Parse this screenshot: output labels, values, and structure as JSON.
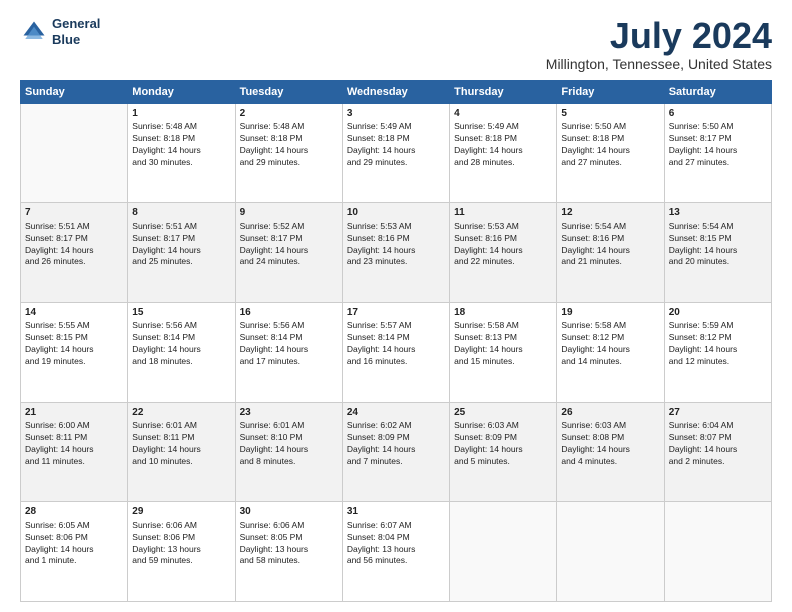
{
  "logo": {
    "line1": "General",
    "line2": "Blue"
  },
  "title": "July 2024",
  "subtitle": "Millington, Tennessee, United States",
  "days_of_week": [
    "Sunday",
    "Monday",
    "Tuesday",
    "Wednesday",
    "Thursday",
    "Friday",
    "Saturday"
  ],
  "weeks": [
    [
      {
        "day": "",
        "info": ""
      },
      {
        "day": "1",
        "info": "Sunrise: 5:48 AM\nSunset: 8:18 PM\nDaylight: 14 hours\nand 30 minutes."
      },
      {
        "day": "2",
        "info": "Sunrise: 5:48 AM\nSunset: 8:18 PM\nDaylight: 14 hours\nand 29 minutes."
      },
      {
        "day": "3",
        "info": "Sunrise: 5:49 AM\nSunset: 8:18 PM\nDaylight: 14 hours\nand 29 minutes."
      },
      {
        "day": "4",
        "info": "Sunrise: 5:49 AM\nSunset: 8:18 PM\nDaylight: 14 hours\nand 28 minutes."
      },
      {
        "day": "5",
        "info": "Sunrise: 5:50 AM\nSunset: 8:18 PM\nDaylight: 14 hours\nand 27 minutes."
      },
      {
        "day": "6",
        "info": "Sunrise: 5:50 AM\nSunset: 8:17 PM\nDaylight: 14 hours\nand 27 minutes."
      }
    ],
    [
      {
        "day": "7",
        "info": "Sunrise: 5:51 AM\nSunset: 8:17 PM\nDaylight: 14 hours\nand 26 minutes."
      },
      {
        "day": "8",
        "info": "Sunrise: 5:51 AM\nSunset: 8:17 PM\nDaylight: 14 hours\nand 25 minutes."
      },
      {
        "day": "9",
        "info": "Sunrise: 5:52 AM\nSunset: 8:17 PM\nDaylight: 14 hours\nand 24 minutes."
      },
      {
        "day": "10",
        "info": "Sunrise: 5:53 AM\nSunset: 8:16 PM\nDaylight: 14 hours\nand 23 minutes."
      },
      {
        "day": "11",
        "info": "Sunrise: 5:53 AM\nSunset: 8:16 PM\nDaylight: 14 hours\nand 22 minutes."
      },
      {
        "day": "12",
        "info": "Sunrise: 5:54 AM\nSunset: 8:16 PM\nDaylight: 14 hours\nand 21 minutes."
      },
      {
        "day": "13",
        "info": "Sunrise: 5:54 AM\nSunset: 8:15 PM\nDaylight: 14 hours\nand 20 minutes."
      }
    ],
    [
      {
        "day": "14",
        "info": "Sunrise: 5:55 AM\nSunset: 8:15 PM\nDaylight: 14 hours\nand 19 minutes."
      },
      {
        "day": "15",
        "info": "Sunrise: 5:56 AM\nSunset: 8:14 PM\nDaylight: 14 hours\nand 18 minutes."
      },
      {
        "day": "16",
        "info": "Sunrise: 5:56 AM\nSunset: 8:14 PM\nDaylight: 14 hours\nand 17 minutes."
      },
      {
        "day": "17",
        "info": "Sunrise: 5:57 AM\nSunset: 8:14 PM\nDaylight: 14 hours\nand 16 minutes."
      },
      {
        "day": "18",
        "info": "Sunrise: 5:58 AM\nSunset: 8:13 PM\nDaylight: 14 hours\nand 15 minutes."
      },
      {
        "day": "19",
        "info": "Sunrise: 5:58 AM\nSunset: 8:12 PM\nDaylight: 14 hours\nand 14 minutes."
      },
      {
        "day": "20",
        "info": "Sunrise: 5:59 AM\nSunset: 8:12 PM\nDaylight: 14 hours\nand 12 minutes."
      }
    ],
    [
      {
        "day": "21",
        "info": "Sunrise: 6:00 AM\nSunset: 8:11 PM\nDaylight: 14 hours\nand 11 minutes."
      },
      {
        "day": "22",
        "info": "Sunrise: 6:01 AM\nSunset: 8:11 PM\nDaylight: 14 hours\nand 10 minutes."
      },
      {
        "day": "23",
        "info": "Sunrise: 6:01 AM\nSunset: 8:10 PM\nDaylight: 14 hours\nand 8 minutes."
      },
      {
        "day": "24",
        "info": "Sunrise: 6:02 AM\nSunset: 8:09 PM\nDaylight: 14 hours\nand 7 minutes."
      },
      {
        "day": "25",
        "info": "Sunrise: 6:03 AM\nSunset: 8:09 PM\nDaylight: 14 hours\nand 5 minutes."
      },
      {
        "day": "26",
        "info": "Sunrise: 6:03 AM\nSunset: 8:08 PM\nDaylight: 14 hours\nand 4 minutes."
      },
      {
        "day": "27",
        "info": "Sunrise: 6:04 AM\nSunset: 8:07 PM\nDaylight: 14 hours\nand 2 minutes."
      }
    ],
    [
      {
        "day": "28",
        "info": "Sunrise: 6:05 AM\nSunset: 8:06 PM\nDaylight: 14 hours\nand 1 minute."
      },
      {
        "day": "29",
        "info": "Sunrise: 6:06 AM\nSunset: 8:06 PM\nDaylight: 13 hours\nand 59 minutes."
      },
      {
        "day": "30",
        "info": "Sunrise: 6:06 AM\nSunset: 8:05 PM\nDaylight: 13 hours\nand 58 minutes."
      },
      {
        "day": "31",
        "info": "Sunrise: 6:07 AM\nSunset: 8:04 PM\nDaylight: 13 hours\nand 56 minutes."
      },
      {
        "day": "",
        "info": ""
      },
      {
        "day": "",
        "info": ""
      },
      {
        "day": "",
        "info": ""
      }
    ]
  ]
}
